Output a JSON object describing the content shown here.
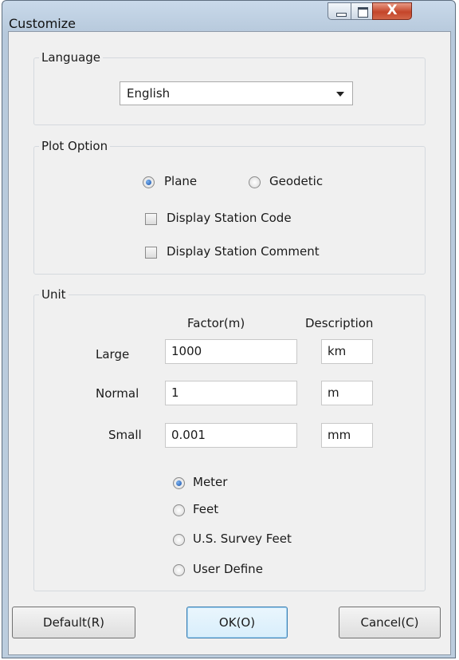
{
  "window": {
    "title": "Customize",
    "close_glyph": "X"
  },
  "language": {
    "label": "Language",
    "selected": "English"
  },
  "plot_option": {
    "label": "Plot Option",
    "plane": {
      "label": "Plane",
      "checked": true
    },
    "geodetic": {
      "label": "Geodetic",
      "checked": false
    },
    "display_station_code": {
      "label": "Display Station Code",
      "checked": false
    },
    "display_station_comment": {
      "label": "Display Station Comment",
      "checked": false
    }
  },
  "unit": {
    "label": "Unit",
    "factor_header": "Factor(m)",
    "description_header": "Description",
    "rows": [
      {
        "label": "Large",
        "factor": "1000",
        "description": "km"
      },
      {
        "label": "Normal",
        "factor": "1",
        "description": "m"
      },
      {
        "label": "Small",
        "factor": "0.001",
        "description": "mm"
      }
    ],
    "systems": [
      {
        "label": "Meter",
        "checked": true
      },
      {
        "label": "Feet",
        "checked": false
      },
      {
        "label": "U.S. Survey Feet",
        "checked": false
      },
      {
        "label": "User Define",
        "checked": false
      }
    ]
  },
  "buttons": {
    "default": "Default(R)",
    "ok": "OK(O)",
    "cancel": "Cancel(C)"
  },
  "icons": {
    "minimize": "minimize-icon",
    "maximize": "maximize-icon",
    "close": "close-icon",
    "dropdown": "chevron-down-icon"
  }
}
